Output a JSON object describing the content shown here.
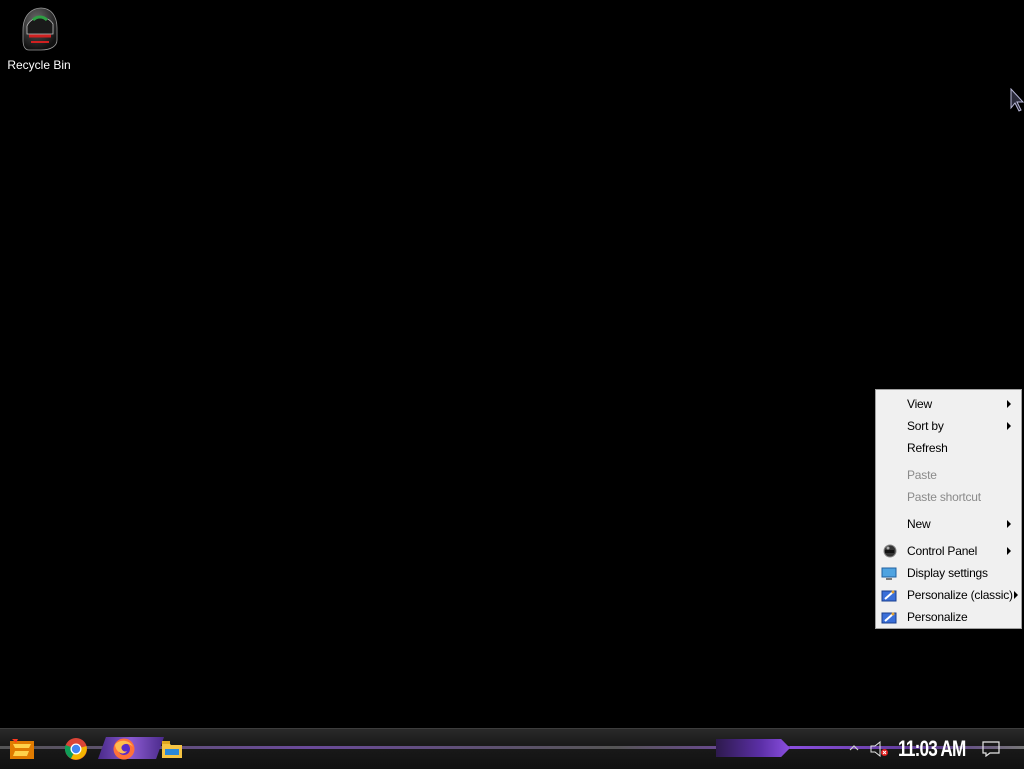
{
  "desktop": {
    "icons": [
      {
        "label": "Recycle Bin",
        "icon": "recycle-bin-icon"
      }
    ]
  },
  "context_menu": {
    "items": [
      {
        "label": "View",
        "submenu": true,
        "enabled": true
      },
      {
        "label": "Sort by",
        "submenu": true,
        "enabled": true
      },
      {
        "label": "Refresh",
        "submenu": false,
        "enabled": true
      },
      {
        "label": "Paste",
        "submenu": false,
        "enabled": false
      },
      {
        "label": "Paste shortcut",
        "submenu": false,
        "enabled": false
      },
      {
        "label": "New",
        "submenu": true,
        "enabled": true
      },
      {
        "label": "Control Panel",
        "submenu": true,
        "enabled": true,
        "icon": "control-panel-icon"
      },
      {
        "label": "Display settings",
        "submenu": false,
        "enabled": true,
        "icon": "display-settings-icon"
      },
      {
        "label": "Personalize (classic)",
        "submenu": true,
        "enabled": true,
        "icon": "personalize-icon"
      },
      {
        "label": "Personalize",
        "submenu": false,
        "enabled": true,
        "icon": "personalize-icon"
      }
    ]
  },
  "taskbar": {
    "pinned": [
      {
        "name": "start",
        "icon": "start-icon"
      },
      {
        "name": "chrome",
        "icon": "chrome-icon"
      },
      {
        "name": "firefox",
        "icon": "firefox-icon"
      },
      {
        "name": "file-explorer",
        "icon": "folder-icon"
      }
    ],
    "tray": {
      "clock": "11:03 AM",
      "volume_icon": "volume-muted-icon",
      "notifications_icon": "action-center-icon"
    },
    "accent_color": "#7b3fc4"
  }
}
